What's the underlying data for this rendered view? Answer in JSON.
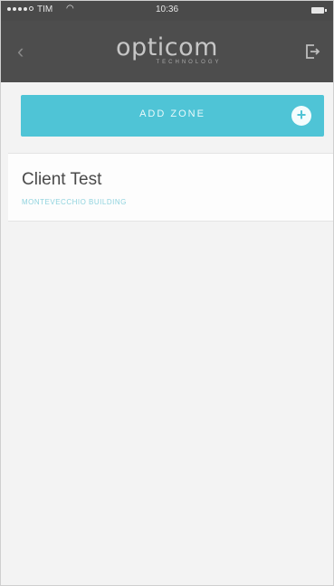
{
  "status_bar": {
    "carrier": "TIM",
    "time": "10:36"
  },
  "header": {
    "logo_main": "opticom",
    "logo_sub": "TECHNOLOGY"
  },
  "actions": {
    "add_zone_label": "ADD ZONE",
    "add_zone_color": "#4fc4d6"
  },
  "clients": [
    {
      "name": "Client Test",
      "building": "MONTEVECCHIO BUILDING"
    }
  ]
}
